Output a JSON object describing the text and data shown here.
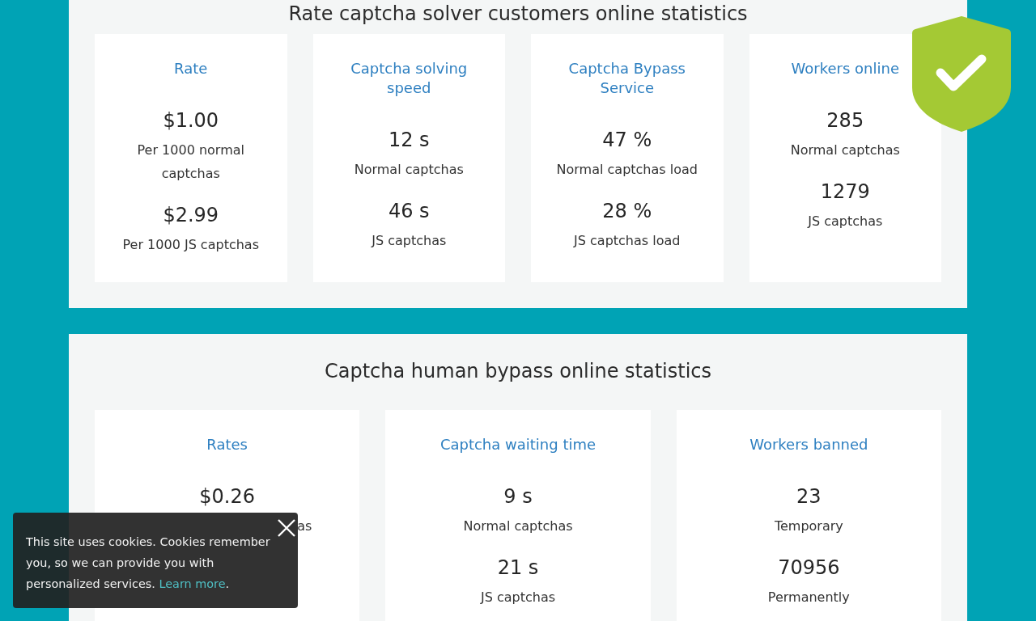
{
  "sections": [
    {
      "title": "Rate captcha solver customers online statistics",
      "cards": [
        {
          "title": "Rate",
          "stats": [
            {
              "value": "$1.00",
              "label": "Per 1000 normal captchas",
              "cut": false
            },
            {
              "value": "$2.99",
              "label": "Per 1000 JS captchas",
              "cut": false
            }
          ]
        },
        {
          "title": "Captcha solving speed",
          "stats": [
            {
              "value": "12 s",
              "label": "Normal captchas",
              "cut": false
            },
            {
              "value": "46 s",
              "label": "JS captchas",
              "cut": false
            }
          ]
        },
        {
          "title": "Captcha Bypass Service",
          "stats": [
            {
              "value": "47 %",
              "label": "Normal captchas load",
              "cut": false
            },
            {
              "value": "28 %",
              "label": "JS captchas load",
              "cut": false
            }
          ]
        },
        {
          "title": "Workers online",
          "stats": [
            {
              "value": "285",
              "label": "Normal captchas",
              "cut": false
            },
            {
              "value": "1279",
              "label": "JS captchas",
              "cut": false
            }
          ]
        }
      ]
    },
    {
      "title": "Captcha human bypass online statistics",
      "cards": [
        {
          "title": "Rates",
          "stats": [
            {
              "value": "$0.26",
              "label": "as",
              "cut": true
            }
          ]
        },
        {
          "title": "Captcha waiting time",
          "stats": [
            {
              "value": "9 s",
              "label": "Normal captchas",
              "cut": false
            },
            {
              "value": "21 s",
              "label": "JS captchas",
              "cut": false
            }
          ]
        },
        {
          "title": "Workers banned",
          "stats": [
            {
              "value": "23",
              "label": "Temporary",
              "cut": false
            },
            {
              "value": "70956",
              "label": "Permanently",
              "cut": false
            }
          ]
        }
      ]
    }
  ],
  "cookie_notice": {
    "text": "This site uses cookies. Cookies remember you, so we can provide you with personalized services.",
    "link": "Learn more",
    "text_end": "."
  }
}
